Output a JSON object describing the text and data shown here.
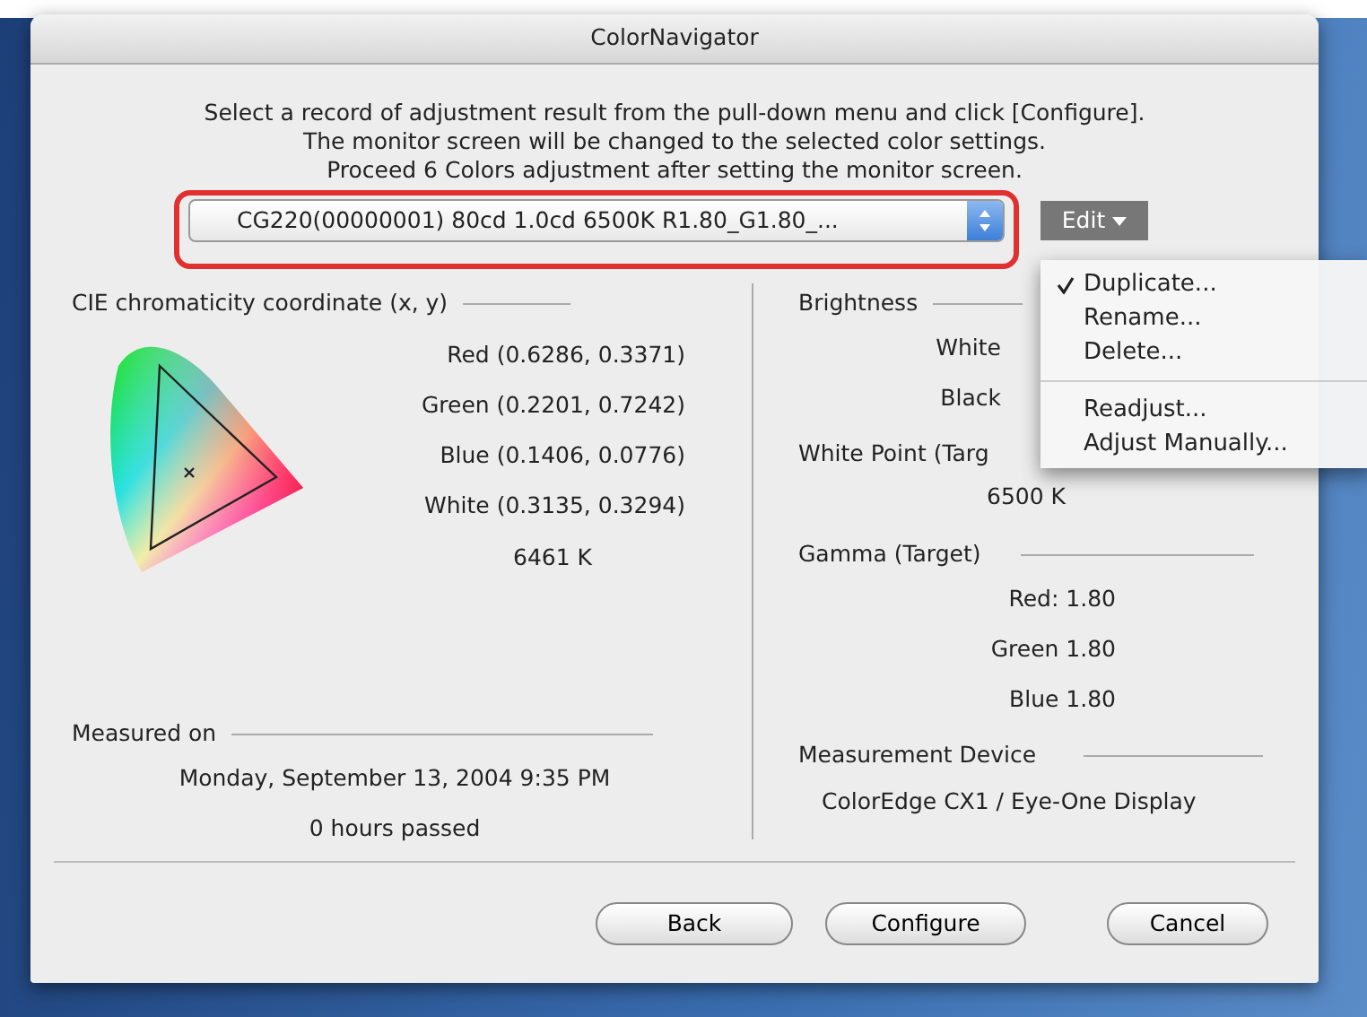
{
  "window": {
    "title": "ColorNavigator"
  },
  "instructions": [
    "Select a record of adjustment result from the pull-down menu and click [Configure].",
    "The monitor screen will be changed to the selected color settings.",
    "Proceed 6 Colors adjustment after setting the monitor screen."
  ],
  "record_select": {
    "value": "CG220(00000001) 80cd 1.0cd 6500K R1.80_G1.80_...",
    "highlighted": true
  },
  "edit_menu": {
    "label": "Edit",
    "expanded": true,
    "groups": [
      [
        {
          "label": "Duplicate...",
          "checked": true
        },
        {
          "label": "Rename...",
          "checked": false
        },
        {
          "label": "Delete...",
          "checked": false
        }
      ],
      [
        {
          "label": "Readjust...",
          "checked": false
        },
        {
          "label": "Adjust Manually...",
          "checked": false
        }
      ]
    ]
  },
  "chromaticity": {
    "heading": "CIE chromaticity coordinate (x, y)",
    "coordinates": [
      "Red (0.6286, 0.3371)",
      "Green (0.2201, 0.7242)",
      "Blue (0.1406, 0.0776)",
      "White (0.3135, 0.3294)"
    ],
    "temperature": "6461 K"
  },
  "brightness": {
    "heading": "Brightness",
    "rows": [
      "White",
      "Black"
    ]
  },
  "white_point": {
    "heading": "White Point (Targ",
    "value": "6500 K"
  },
  "gamma": {
    "heading": "Gamma (Target)",
    "rows": [
      "Red: 1.80",
      "Green 1.80",
      "Blue 1.80"
    ]
  },
  "measured": {
    "heading": "Measured on",
    "date": "Monday, September 13, 2004 9:35 PM",
    "elapsed": "0 hours passed"
  },
  "device": {
    "heading": "Measurement Device",
    "value": "ColorEdge CX1 / Eye-One Display"
  },
  "buttons": [
    "Back",
    "Configure",
    "Cancel"
  ]
}
